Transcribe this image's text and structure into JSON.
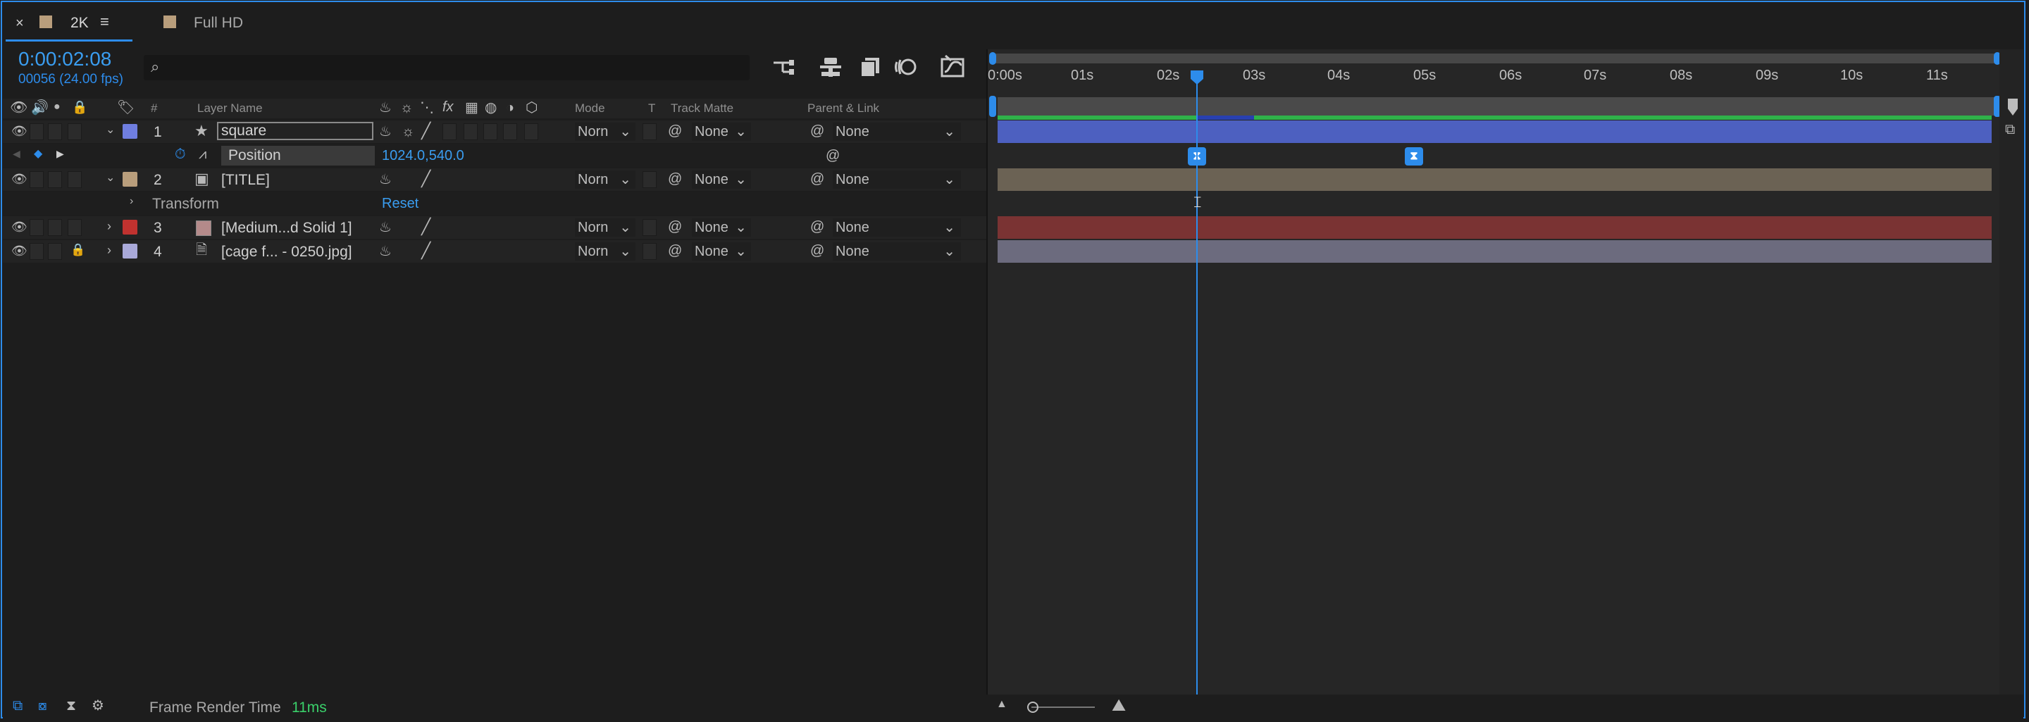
{
  "tabs": [
    {
      "label": "2K",
      "color": "#b99e7c",
      "active": true
    },
    {
      "label": "Full HD",
      "color": "#b99e7c",
      "active": false
    }
  ],
  "timecode": {
    "main": "0:00:02:08",
    "sub": "00056 (24.00 fps)"
  },
  "search": {
    "placeholder": ""
  },
  "columns": {
    "num": "#",
    "layer_name": "Layer Name",
    "mode": "Mode",
    "t": "T",
    "track_matte": "Track Matte",
    "parent_link": "Parent & Link"
  },
  "layers": [
    {
      "num": "1",
      "name": "square",
      "color": "#6f7ee0",
      "mode": "Norn",
      "matte": "None",
      "parent": "None",
      "bar_color": "#4d60c0"
    },
    {
      "num": "2",
      "name": "[TITLE]",
      "color": "#b99e7c",
      "mode": "Norn",
      "matte": "None",
      "parent": "None",
      "bar_color": "#6b6254"
    },
    {
      "num": "3",
      "name": "[Medium...d Solid 1]",
      "color": "#c0322f",
      "mode": "Norn",
      "matte": "None",
      "parent": "None",
      "bar_color": "#7a3333"
    },
    {
      "num": "4",
      "name": "[cage f... - 0250.jpg]",
      "color": "#a9a9d9",
      "mode": "Norn",
      "matte": "None",
      "parent": "None",
      "bar_color": "#6c6b7e"
    }
  ],
  "property": {
    "name": "Position",
    "value": "1024.0,540.0"
  },
  "transform": {
    "label": "Transform",
    "reset": "Reset"
  },
  "ruler": [
    "0:00s",
    "01s",
    "02s",
    "03s",
    "04s",
    "05s",
    "06s",
    "07s",
    "08s",
    "09s",
    "10s",
    "11s"
  ],
  "footer": {
    "label": "Frame Render Time",
    "value": "11ms"
  },
  "colors": {
    "accent": "#2d8ceb",
    "green": "#2fb24a"
  }
}
